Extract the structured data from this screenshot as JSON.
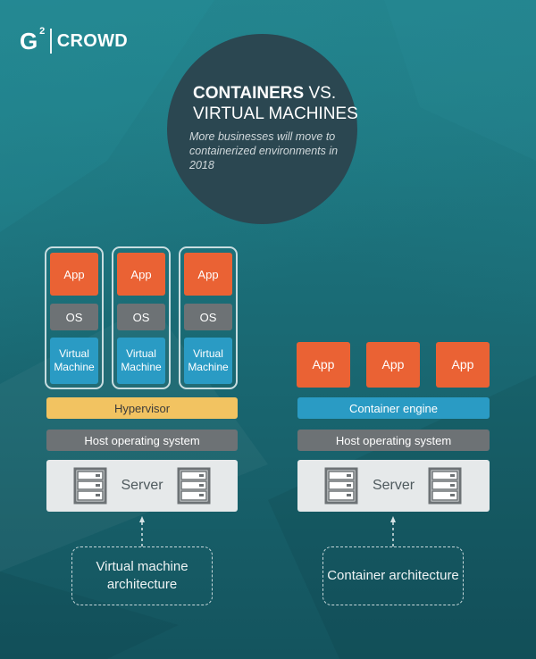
{
  "brand": {
    "logo_mark": "G",
    "logo_sup": "2",
    "logo_text": "CROWD"
  },
  "header": {
    "title_bold": "CONTAINERS",
    "title_rest": " VS.",
    "title_line2": "VIRTUAL MACHINES",
    "subtitle": "More businesses will move to containerized environments in 2018"
  },
  "vm_architecture": {
    "columns": [
      {
        "app": "App",
        "os": "OS",
        "vm": "Virtual Machine"
      },
      {
        "app": "App",
        "os": "OS",
        "vm": "Virtual Machine"
      },
      {
        "app": "App",
        "os": "OS",
        "vm": "Virtual Machine"
      }
    ],
    "hypervisor": "Hypervisor",
    "host_os": "Host operating system",
    "server": "Server",
    "server_icon": "server-rack-icon",
    "label": "Virtual machine architecture"
  },
  "container_architecture": {
    "apps": [
      "App",
      "App",
      "App"
    ],
    "engine": "Container engine",
    "host_os": "Host operating system",
    "server": "Server",
    "server_icon": "server-rack-icon",
    "label": "Container architecture"
  },
  "colors": {
    "app": "#ea6234",
    "os": "#6d7275",
    "virtual_machine": "#2a9bc4",
    "hypervisor": "#f2c361",
    "container_engine": "#2a9bc4",
    "server": "#e6e9ea",
    "title_circle": "#2b4751",
    "background": "#1a6a74"
  }
}
